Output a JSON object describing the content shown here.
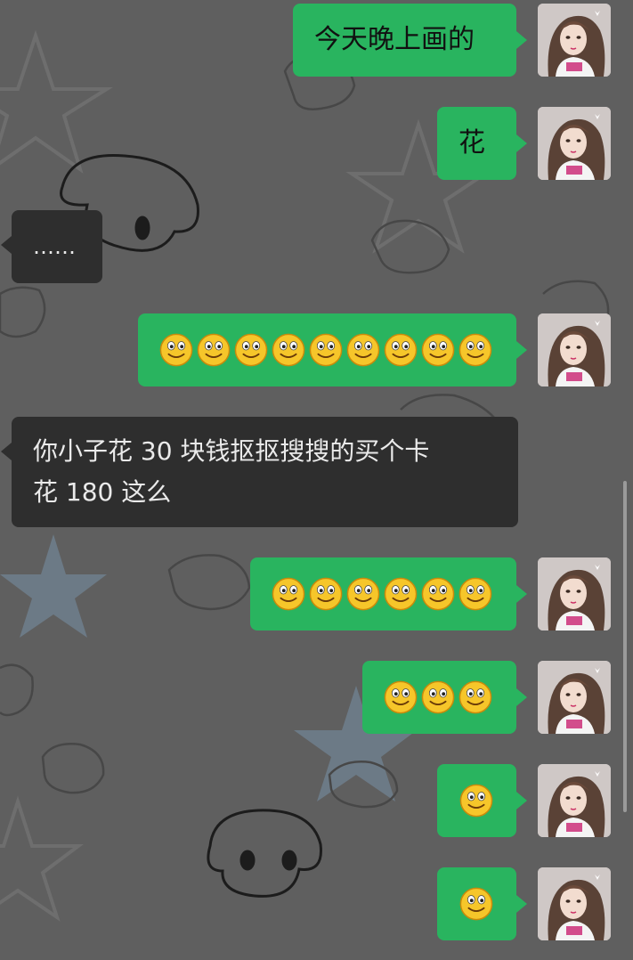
{
  "colors": {
    "background": "#5f5f5f",
    "sent_bubble": "#29b45f",
    "received_bubble": "#2e2e2e",
    "received_text": "#eaeaea"
  },
  "messages": [
    {
      "id": "m1",
      "direction": "sent",
      "text": "今天晚上画的"
    },
    {
      "id": "m2",
      "direction": "sent",
      "text": "花"
    },
    {
      "id": "m3",
      "direction": "received",
      "text": "……"
    },
    {
      "id": "m4",
      "direction": "sent",
      "emoji": "smile",
      "emoji_count": 9
    },
    {
      "id": "m5",
      "direction": "received",
      "text_lines": [
        "你小子花 30 块钱抠抠搜搜的买个卡",
        "花 180 这么"
      ]
    },
    {
      "id": "m6",
      "direction": "sent",
      "emoji": "smile",
      "emoji_count": 6
    },
    {
      "id": "m7",
      "direction": "sent",
      "emoji": "smile",
      "emoji_count": 3
    },
    {
      "id": "m8",
      "direction": "sent",
      "emoji": "smile",
      "emoji_count": 1
    },
    {
      "id": "m9",
      "direction": "sent",
      "emoji": "smile",
      "emoji_count": 1
    }
  ]
}
